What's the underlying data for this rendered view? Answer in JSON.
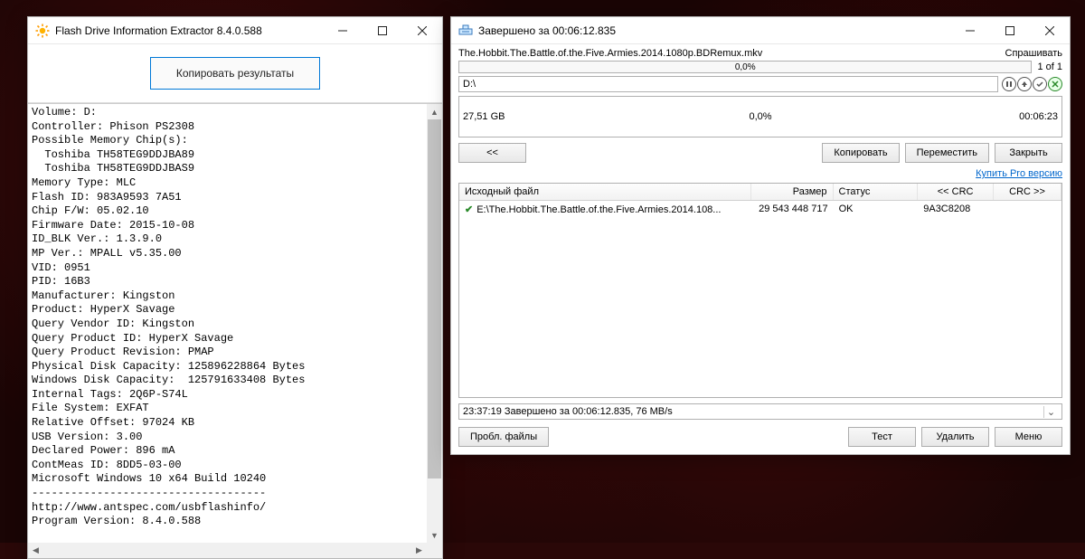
{
  "desktop": {
    "bg_color": "#1a0505"
  },
  "left_window": {
    "title": "Flash Drive Information Extractor 8.4.0.588",
    "copy_button": "Копировать результаты",
    "info_text": "Volume: D:\nController: Phison PS2308\nPossible Memory Chip(s):\n  Toshiba TH58TEG9DDJBA89\n  Toshiba TH58TEG9DDJBAS9\nMemory Type: MLC\nFlash ID: 983A9593 7A51\nChip F/W: 05.02.10\nFirmware Date: 2015-10-08\nID_BLK Ver.: 1.3.9.0\nMP Ver.: MPALL v5.35.00\nVID: 0951\nPID: 16B3\nManufacturer: Kingston\nProduct: HyperX Savage\nQuery Vendor ID: Kingston\nQuery Product ID: HyperX Savage\nQuery Product Revision: PMAP\nPhysical Disk Capacity: 125896228864 Bytes\nWindows Disk Capacity:  125791633408 Bytes\nInternal Tags: 2Q6P-S74L\nFile System: EXFAT\nRelative Offset: 97024 KB\nUSB Version: 3.00\nDeclared Power: 896 mA\nContMeas ID: 8DD5-03-00\nMicrosoft Windows 10 x64 Build 10240\n------------------------------------\nhttp://www.antspec.com/usbflashinfo/\nProgram Version: 8.4.0.588"
  },
  "right_window": {
    "title": "Завершено за 00:06:12.835",
    "filename": "The.Hobbit.The.Battle.of.the.Five.Armies.2014.1080p.BDRemux.mkv",
    "ask_label": "Спрашивать",
    "file_progress": {
      "percent": "0,0%",
      "count": "1 of 1"
    },
    "drive": "D:\\",
    "icons": [
      "pause",
      "up",
      "confirm",
      "cancel"
    ],
    "total_size": "27,51 GB",
    "total_percent": "0,0%",
    "total_time": "00:06:23",
    "buttons": {
      "back": "<<",
      "copy": "Копировать",
      "move": "Переместить",
      "close": "Закрыть"
    },
    "pro_link": "Купить Pro версию",
    "columns": {
      "src": "Исходный файл",
      "size": "Размер",
      "status": "Статус",
      "crc_in": "<< CRC",
      "crc_out": "CRC >>"
    },
    "rows": [
      {
        "ok": true,
        "src": "E:\\The.Hobbit.The.Battle.of.the.Five.Armies.2014.108...",
        "size": "29 543 448 717",
        "status": "OK",
        "crc_in": "9A3C8208",
        "crc_out": ""
      }
    ],
    "status_line": "23:37:19 Завершено за 00:06:12.835, 76 MB/s",
    "bottom_buttons": {
      "problems": "Пробл. файлы",
      "test": "Тест",
      "delete": "Удалить",
      "menu": "Меню"
    }
  }
}
